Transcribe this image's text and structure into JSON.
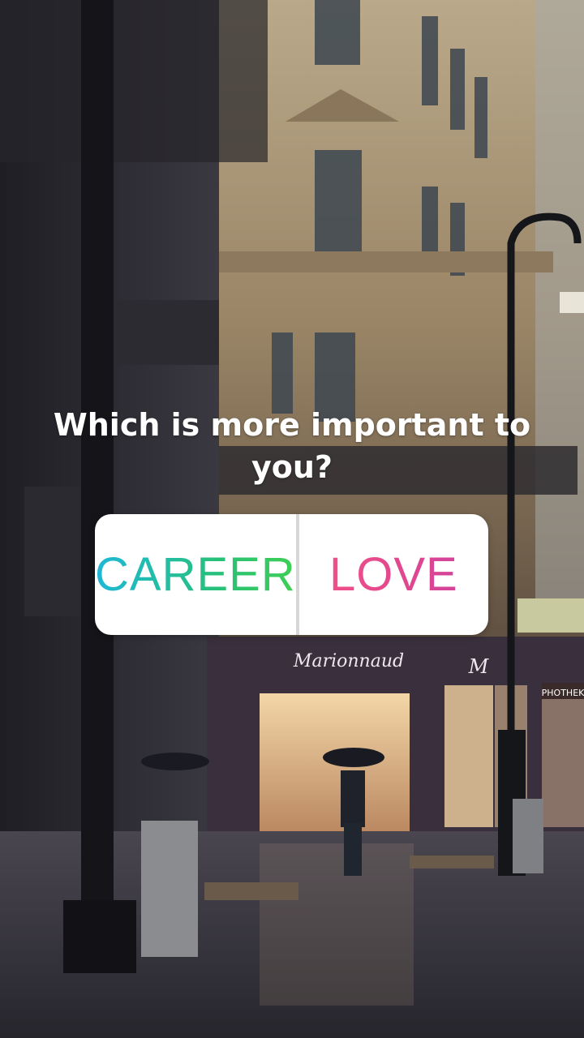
{
  "question": "Which is more important to you?",
  "poll": {
    "options": [
      {
        "label": "CAREER",
        "colors": [
          "#1eb8d8",
          "#3fcf53"
        ]
      },
      {
        "label": "LOVE",
        "colors": [
          "#f0508a",
          "#d2449b"
        ]
      }
    ]
  },
  "background": {
    "store_sign": "Marionnaud",
    "store_logo": "M",
    "side_sign": "PHOTHEK"
  }
}
